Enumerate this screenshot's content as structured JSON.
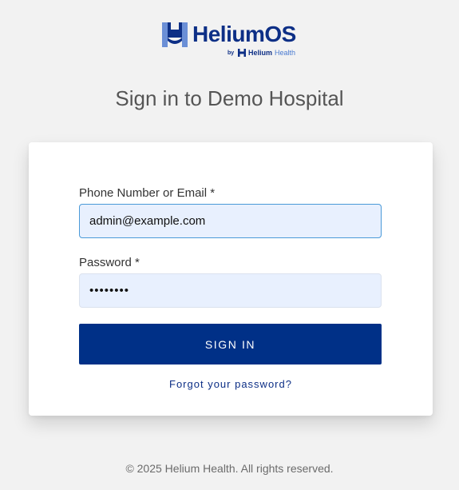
{
  "brand": {
    "name": "HeliumOS",
    "by_text": "by",
    "parent_name_1": "Helium",
    "parent_name_2": "Health",
    "colors": {
      "primary": "#0d2f86",
      "accent": "#4a7bd1",
      "button": "#003087",
      "input_bg": "#e8f0fe"
    },
    "icon": "helium-h-logo-icon"
  },
  "page": {
    "title": "Sign in to Demo Hospital"
  },
  "form": {
    "email_label": "Phone Number or Email *",
    "email_value": "admin@example.com",
    "password_label": "Password *",
    "password_value": "••••••••",
    "submit_label": "SIGN IN",
    "forgot_label": "Forgot your password?"
  },
  "footer": {
    "text": "© 2025 Helium Health. All rights reserved."
  }
}
